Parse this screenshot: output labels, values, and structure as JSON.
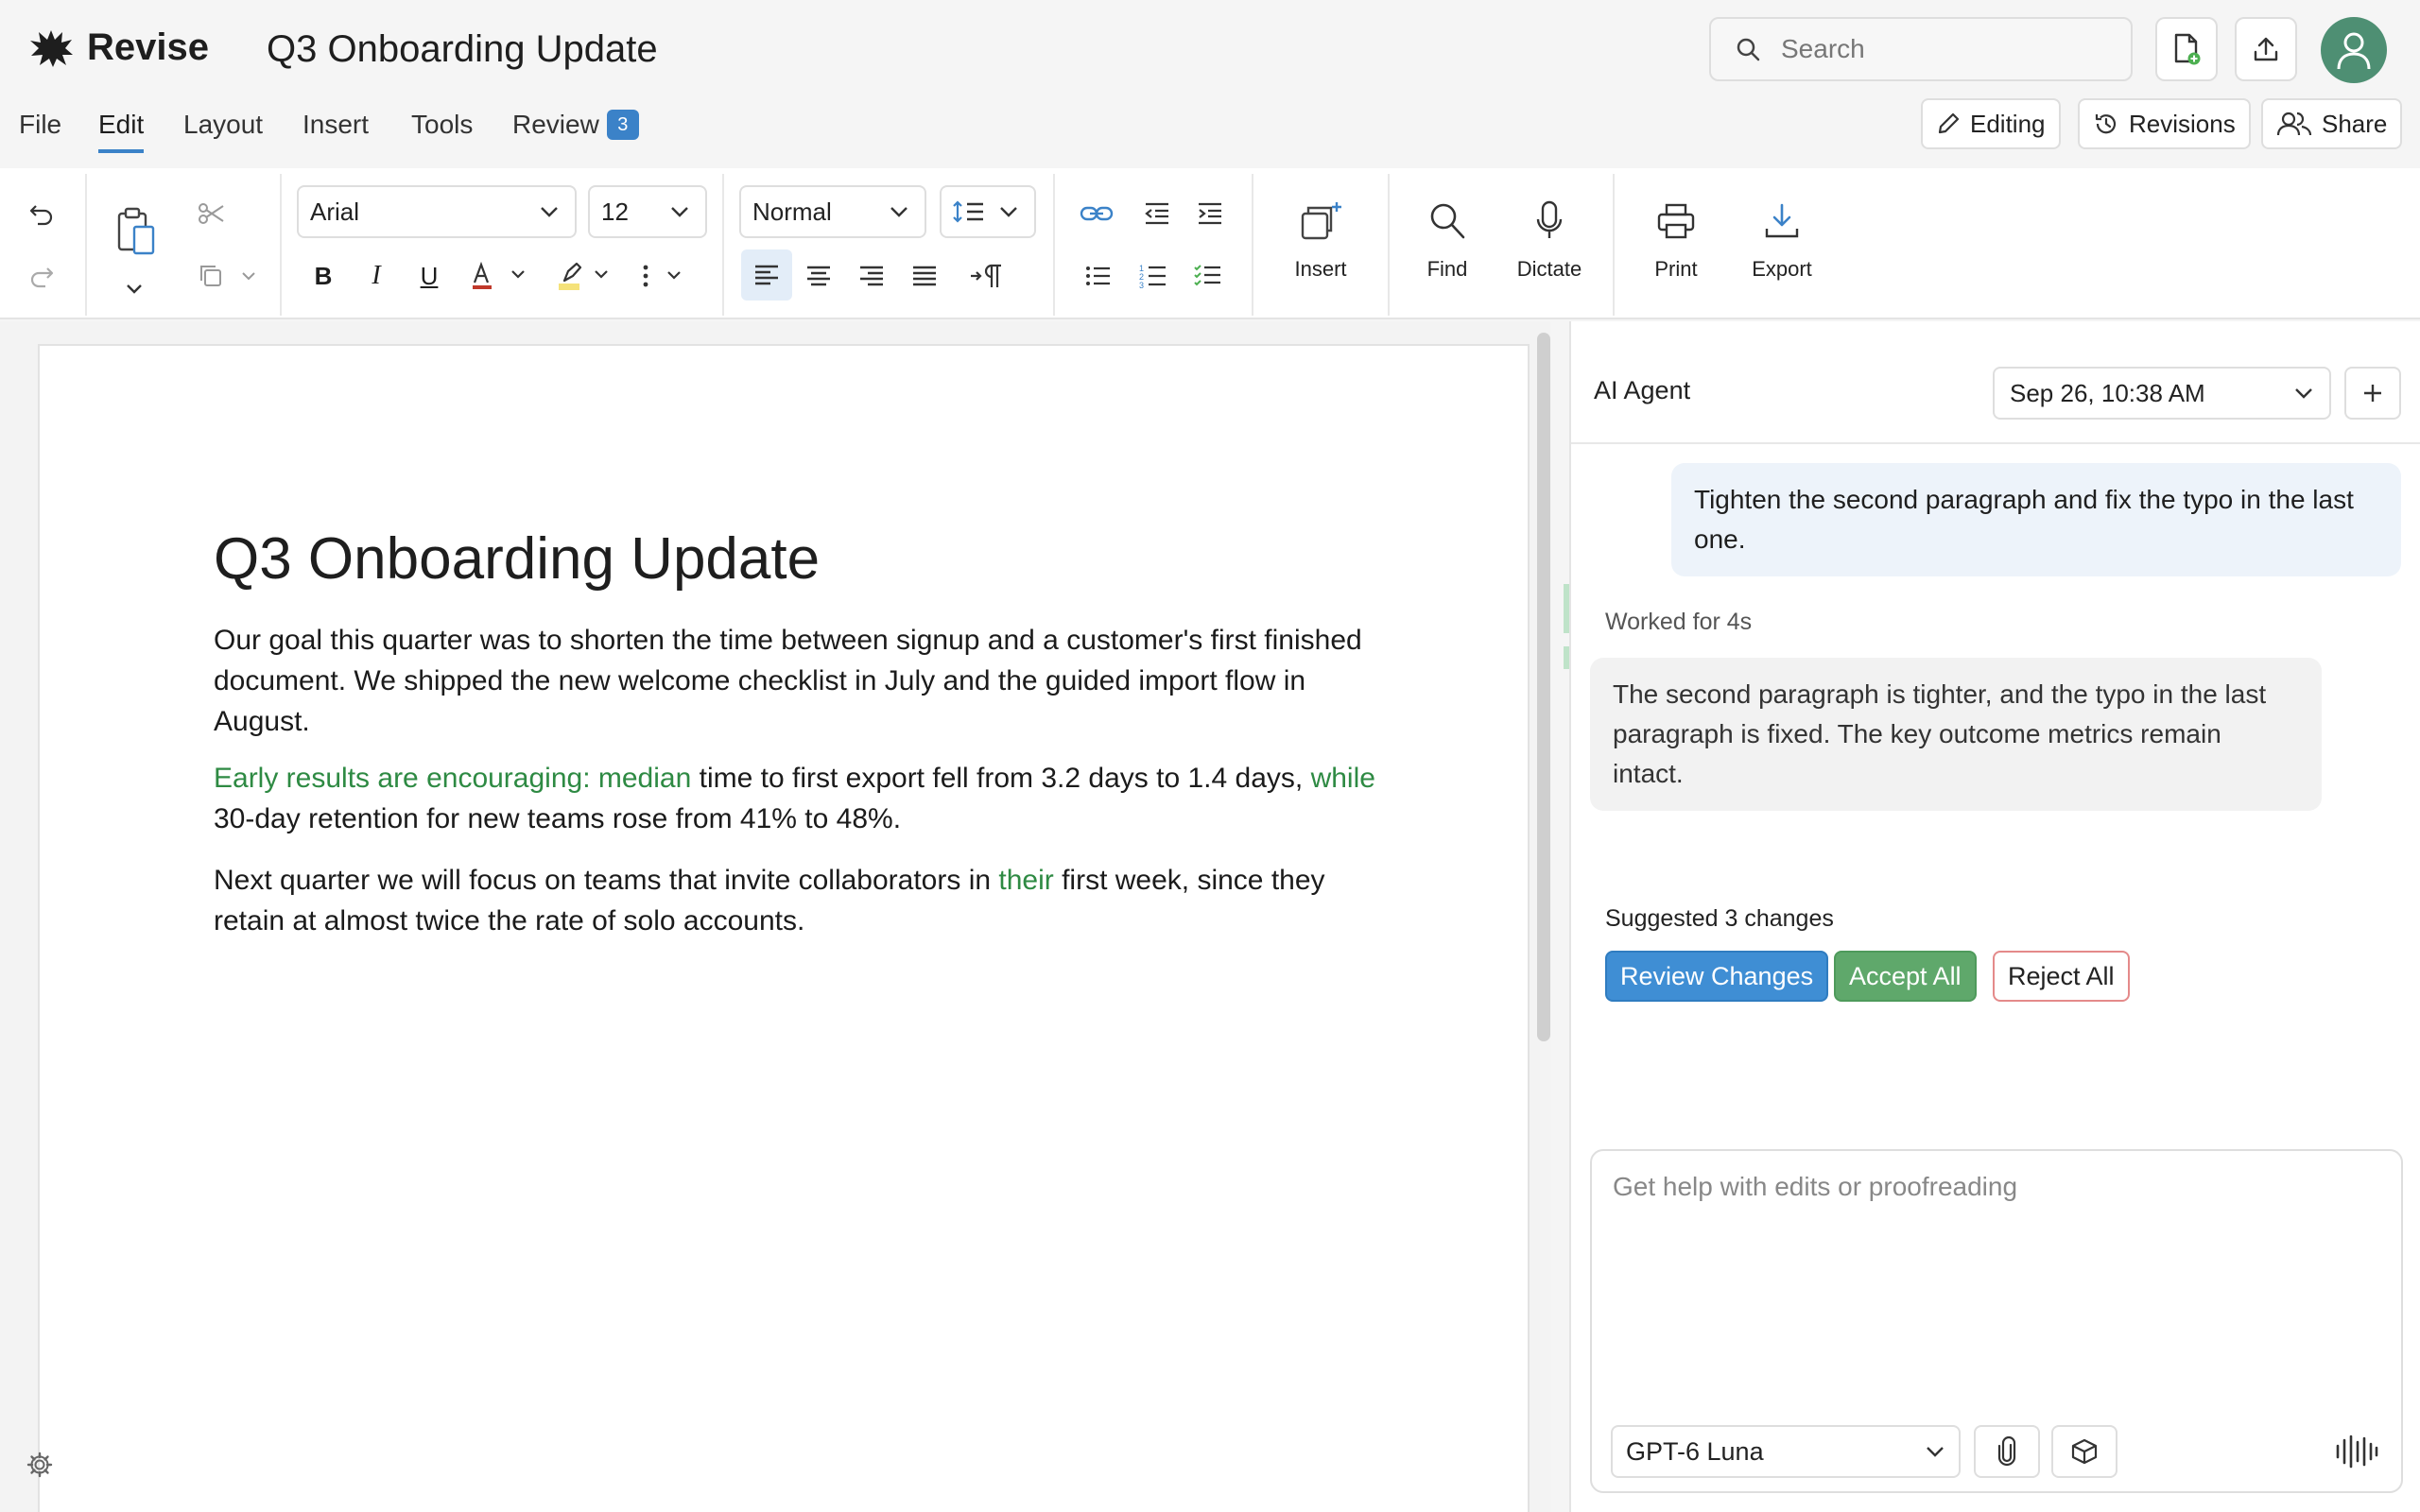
{
  "app": {
    "name": "Revise",
    "doc_title": "Q3 Onboarding Update"
  },
  "header": {
    "search_placeholder": "Search"
  },
  "menu": {
    "items": [
      "File",
      "Edit",
      "Layout",
      "Insert",
      "Tools",
      "Review"
    ],
    "active": "Edit",
    "review_badge": "3"
  },
  "modes": {
    "editing": "Editing",
    "revisions": "Revisions",
    "share": "Share"
  },
  "toolbar": {
    "font_family": "Arial",
    "font_size": "12",
    "paragraph_style": "Normal",
    "insert_label": "Insert",
    "find_label": "Find",
    "dictate_label": "Dictate",
    "print_label": "Print",
    "export_label": "Export",
    "font_color": "#c0392b",
    "highlight_color": "#f5e27a"
  },
  "document": {
    "heading": "Q3 Onboarding Update",
    "p1": "Our goal this quarter was to shorten the time between signup and a customer's first finished document. We shipped the new welcome checklist in July and the guided import flow in August.",
    "p2_ins1": "Early results are encouraging: median",
    "p2_mid": " time to first export fell from 3.2 days to 1.4 days, ",
    "p2_ins2": "while",
    "p2_end": " 30-day retention for new teams rose from 41% to 48%.",
    "p3_start": "Next quarter we will focus on teams that invite collaborators in ",
    "p3_ins": "their",
    "p3_end": " first week, since they retain at almost twice the rate of solo accounts."
  },
  "agent": {
    "title": "AI Agent",
    "session": "Sep 26, 10:38 AM",
    "user_message": "Tighten the second paragraph and fix the typo in the last one.",
    "worked": "Worked for 4s",
    "reply": "The second paragraph is tighter, and the typo in the last paragraph is fixed. The key outcome metrics remain intact.",
    "suggested": "Suggested 3 changes",
    "review_changes": "Review Changes",
    "accept_all": "Accept All",
    "reject_all": "Reject All",
    "input_placeholder": "Get help with edits or proofreading",
    "model": "GPT-6 Luna"
  },
  "colors": {
    "accent": "#3b82c8",
    "insertion": "#2e8a43",
    "accept": "#5fa86b",
    "reject_border": "#e48a8a"
  }
}
